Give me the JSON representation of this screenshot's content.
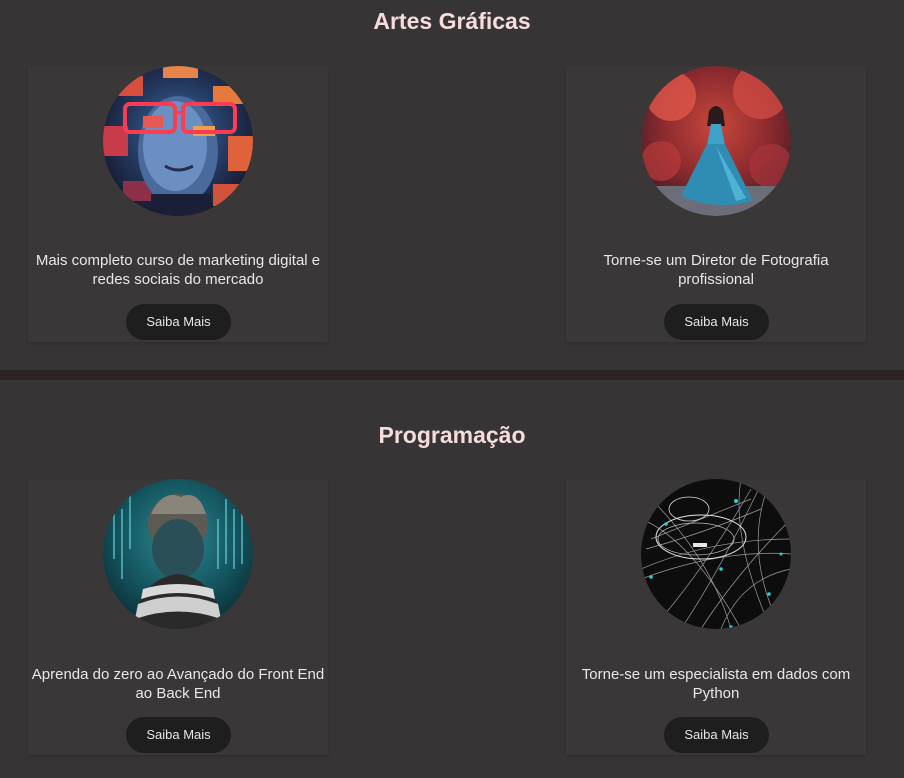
{
  "sections": [
    {
      "title": "Artes Gráficas",
      "cards": [
        {
          "image": "glitch-portrait-with-red-glasses",
          "description": "Mais completo curso de marketing digital e redes sociais do mercado",
          "button": "Saiba Mais"
        },
        {
          "image": "woman-blue-dress-red-forest",
          "description": "Torne-se um Diretor de Fotografia profissional",
          "button": "Saiba Mais"
        }
      ]
    },
    {
      "title": "Programação",
      "cards": [
        {
          "image": "boy-facing-code-screen",
          "description": "Aprenda do zero ao Avançado do Front End ao Back End",
          "button": "Saiba Mais"
        },
        {
          "image": "data-network-lines",
          "description": "Torne-se um especialista em dados com Python",
          "button": "Saiba Mais"
        }
      ]
    }
  ],
  "colors": {
    "background": "#363435",
    "title": "#f7dcdc",
    "divider": "#2b2223",
    "button": "#1f1e1e"
  }
}
